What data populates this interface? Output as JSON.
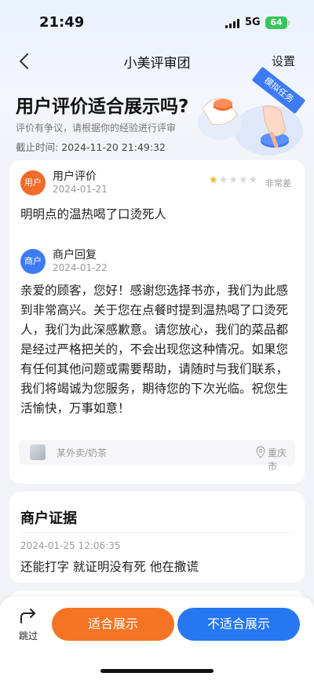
{
  "status_bar": {
    "time": "21:49",
    "network": "5G",
    "battery": "64"
  },
  "nav": {
    "title": "小美评审团",
    "settings_label": "设置"
  },
  "header": {
    "title": "用户评价适合展示吗?",
    "subtitle": "评价有争议，请根据你的经验进行评审",
    "deadline_label": "截止时间:",
    "deadline_value": "2024-11-20 21:49:32",
    "badge": "模拟任务"
  },
  "review": {
    "avatar_label": "用户",
    "title": "用户评价",
    "date": "2024-01-21",
    "rating": 1,
    "rating_max": 5,
    "rating_word": "非常差",
    "text": "明明点的温热喝了口烫死人"
  },
  "merchant_reply": {
    "avatar_label": "商户",
    "title": "商户回复",
    "date": "2024-01-22",
    "text": "亲爱的顾客，您好！感谢您选择书亦，我们为此感到非常高兴。关于您在点餐时提到温热喝了口烫死人，我们为此深感歉意。请您放心，我们的菜品都是经过严格把关的，不会出现您这种情况。如果您有任何其他问题或需要帮助，请随时与我们联系，我们将竭诚为您服务，期待您的下次光临。祝您生活愉快，万事如意！"
  },
  "shop_info": {
    "shop_name": "某外卖/奶茶",
    "city": "重庆市"
  },
  "evidence": {
    "title": "商户证据",
    "time": "2024-01-25 12:06:35",
    "text": "还能打字 就证明没有死 他在撒谎"
  },
  "actions": {
    "skip_label": "跳过",
    "suitable_label": "适合展示",
    "unsuitable_label": "不适合展示"
  },
  "colors": {
    "orange": "#f57424",
    "blue": "#2877f2",
    "star": "#f5b61a"
  }
}
